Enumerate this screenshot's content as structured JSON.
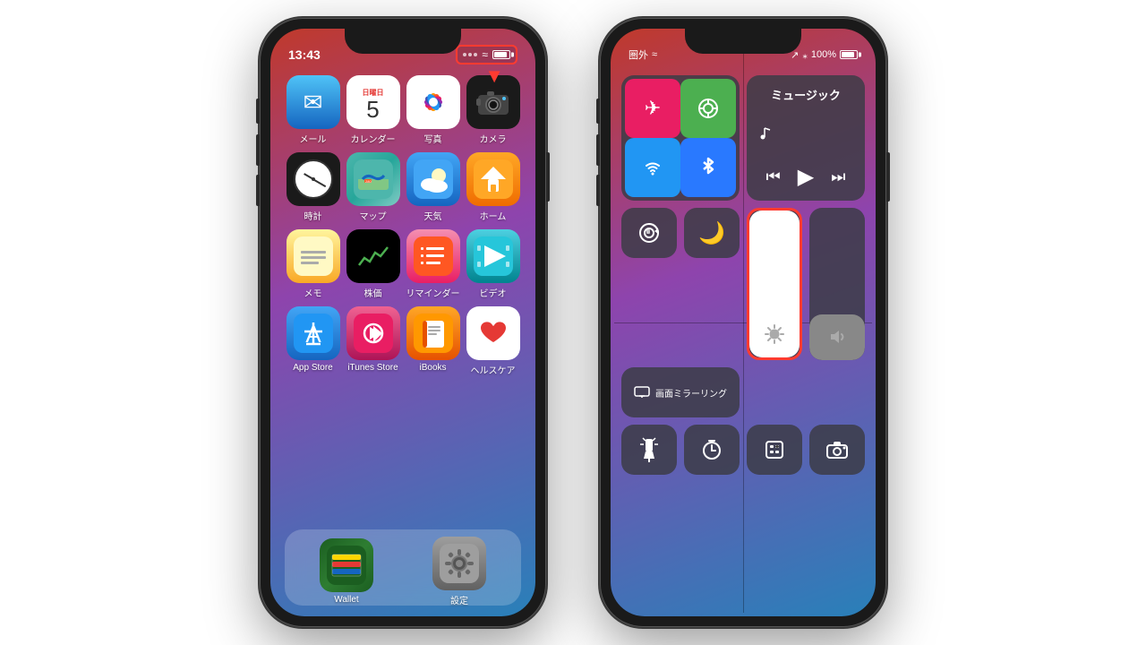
{
  "page": {
    "background": "#ffffff"
  },
  "phone1": {
    "status": {
      "time": "13:43",
      "signal_dots": 3,
      "wifi": "wifi",
      "battery": "battery"
    },
    "highlight_label": "status bar right icons highlighted",
    "apps": [
      {
        "id": "mail",
        "label": "メール",
        "icon": "mail",
        "row": 1
      },
      {
        "id": "calendar",
        "label": "カレンダー",
        "icon": "calendar",
        "row": 1
      },
      {
        "id": "photos",
        "label": "写真",
        "icon": "photos",
        "row": 1
      },
      {
        "id": "camera",
        "label": "カメラ",
        "icon": "camera",
        "row": 1
      },
      {
        "id": "clock",
        "label": "時計",
        "icon": "clock",
        "row": 2
      },
      {
        "id": "maps",
        "label": "マップ",
        "icon": "maps",
        "row": 2
      },
      {
        "id": "weather",
        "label": "天気",
        "icon": "weather",
        "row": 2
      },
      {
        "id": "home",
        "label": "ホーム",
        "icon": "home",
        "row": 2
      },
      {
        "id": "notes",
        "label": "メモ",
        "icon": "notes",
        "row": 3
      },
      {
        "id": "stocks",
        "label": "株価",
        "icon": "stocks",
        "row": 3
      },
      {
        "id": "reminders",
        "label": "リマインダー",
        "icon": "reminders",
        "row": 3
      },
      {
        "id": "videos",
        "label": "ビデオ",
        "icon": "videos",
        "row": 3
      },
      {
        "id": "appstore",
        "label": "App Store",
        "icon": "appstore",
        "row": 4
      },
      {
        "id": "itunes",
        "label": "iTunes Store",
        "icon": "itunes",
        "row": 4
      },
      {
        "id": "ibooks",
        "label": "iBooks",
        "icon": "ibooks",
        "row": 4
      },
      {
        "id": "health",
        "label": "ヘルスケア",
        "icon": "health",
        "row": 4
      },
      {
        "id": "wallet",
        "label": "Wallet",
        "icon": "wallet",
        "row": 5
      },
      {
        "id": "settings",
        "label": "設定",
        "icon": "settings",
        "row": 5
      }
    ],
    "red_arrow": "▼"
  },
  "phone2": {
    "status": {
      "left": "圏外",
      "wifi": "wifi",
      "right_arrow": "↗",
      "bluetooth": "bt",
      "battery_pct": "100%",
      "battery": "battery"
    },
    "music_label": "ミュージック",
    "connectivity": {
      "airplane": "✈",
      "cellular": "📡",
      "wifi": "wifi",
      "bluetooth": "bt"
    },
    "controls": {
      "rotation_lock": "🔒",
      "do_not_disturb": "🌙",
      "mirror": "画面ミラーリング",
      "brightness_pct": 100,
      "volume_pct": 30
    },
    "bottom_controls": {
      "flashlight": "flashlight",
      "timer": "timer",
      "calculator": "calculator",
      "camera": "camera"
    },
    "highlight_label": "brightness slider highlighted"
  }
}
